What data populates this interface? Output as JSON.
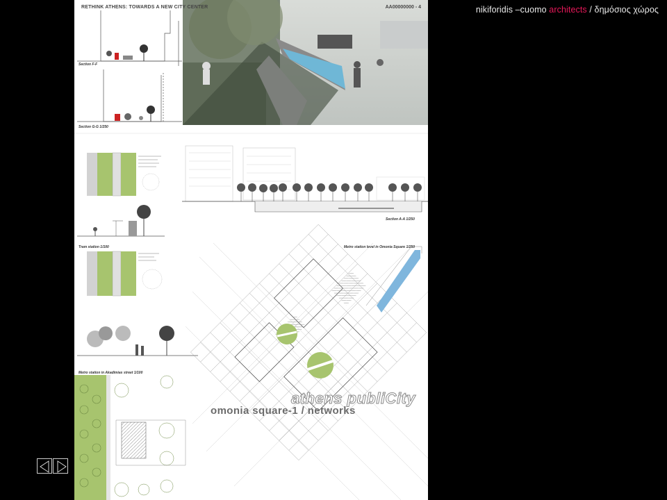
{
  "header": {
    "studio": "nikiforidis –cuomo",
    "architects": "architects",
    "separator": "/",
    "topic": "δημόσιος χώρος"
  },
  "poster": {
    "title": "RETHINK ATHENS: TOWARDS A NEW CITY CENTER",
    "code": "AA00000000 - 4",
    "captions": {
      "section_ff": "Section F-F",
      "section_gg": "Section G-G   1/250",
      "tram_station": "Tram station  1/100",
      "section_aa": "Section A-A   1/250",
      "metro_omonia": "Metro station level  in Omonia Square  1/250",
      "metro_akadimias": "Metro station in Akadimias street  1/100"
    },
    "brand_line1": "athens publiCity",
    "brand_line2": "omonia square-1 / networks"
  },
  "nav": {
    "prev_icon": "prev-arrow-icon",
    "next_icon": "next-arrow-icon"
  },
  "colors": {
    "accent": "#e8185a",
    "green": "#a7c46e",
    "water": "#7fb6dd"
  }
}
